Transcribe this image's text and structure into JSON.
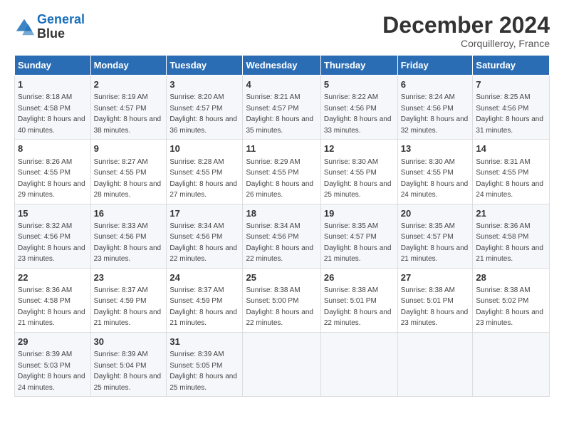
{
  "logo": {
    "line1": "General",
    "line2": "Blue"
  },
  "title": "December 2024",
  "location": "Corquilleroy, France",
  "headers": [
    "Sunday",
    "Monday",
    "Tuesday",
    "Wednesday",
    "Thursday",
    "Friday",
    "Saturday"
  ],
  "weeks": [
    [
      {
        "day": "1",
        "sunrise": "Sunrise: 8:18 AM",
        "sunset": "Sunset: 4:58 PM",
        "daylight": "Daylight: 8 hours and 40 minutes."
      },
      {
        "day": "2",
        "sunrise": "Sunrise: 8:19 AM",
        "sunset": "Sunset: 4:57 PM",
        "daylight": "Daylight: 8 hours and 38 minutes."
      },
      {
        "day": "3",
        "sunrise": "Sunrise: 8:20 AM",
        "sunset": "Sunset: 4:57 PM",
        "daylight": "Daylight: 8 hours and 36 minutes."
      },
      {
        "day": "4",
        "sunrise": "Sunrise: 8:21 AM",
        "sunset": "Sunset: 4:57 PM",
        "daylight": "Daylight: 8 hours and 35 minutes."
      },
      {
        "day": "5",
        "sunrise": "Sunrise: 8:22 AM",
        "sunset": "Sunset: 4:56 PM",
        "daylight": "Daylight: 8 hours and 33 minutes."
      },
      {
        "day": "6",
        "sunrise": "Sunrise: 8:24 AM",
        "sunset": "Sunset: 4:56 PM",
        "daylight": "Daylight: 8 hours and 32 minutes."
      },
      {
        "day": "7",
        "sunrise": "Sunrise: 8:25 AM",
        "sunset": "Sunset: 4:56 PM",
        "daylight": "Daylight: 8 hours and 31 minutes."
      }
    ],
    [
      {
        "day": "8",
        "sunrise": "Sunrise: 8:26 AM",
        "sunset": "Sunset: 4:55 PM",
        "daylight": "Daylight: 8 hours and 29 minutes."
      },
      {
        "day": "9",
        "sunrise": "Sunrise: 8:27 AM",
        "sunset": "Sunset: 4:55 PM",
        "daylight": "Daylight: 8 hours and 28 minutes."
      },
      {
        "day": "10",
        "sunrise": "Sunrise: 8:28 AM",
        "sunset": "Sunset: 4:55 PM",
        "daylight": "Daylight: 8 hours and 27 minutes."
      },
      {
        "day": "11",
        "sunrise": "Sunrise: 8:29 AM",
        "sunset": "Sunset: 4:55 PM",
        "daylight": "Daylight: 8 hours and 26 minutes."
      },
      {
        "day": "12",
        "sunrise": "Sunrise: 8:30 AM",
        "sunset": "Sunset: 4:55 PM",
        "daylight": "Daylight: 8 hours and 25 minutes."
      },
      {
        "day": "13",
        "sunrise": "Sunrise: 8:30 AM",
        "sunset": "Sunset: 4:55 PM",
        "daylight": "Daylight: 8 hours and 24 minutes."
      },
      {
        "day": "14",
        "sunrise": "Sunrise: 8:31 AM",
        "sunset": "Sunset: 4:55 PM",
        "daylight": "Daylight: 8 hours and 24 minutes."
      }
    ],
    [
      {
        "day": "15",
        "sunrise": "Sunrise: 8:32 AM",
        "sunset": "Sunset: 4:56 PM",
        "daylight": "Daylight: 8 hours and 23 minutes."
      },
      {
        "day": "16",
        "sunrise": "Sunrise: 8:33 AM",
        "sunset": "Sunset: 4:56 PM",
        "daylight": "Daylight: 8 hours and 23 minutes."
      },
      {
        "day": "17",
        "sunrise": "Sunrise: 8:34 AM",
        "sunset": "Sunset: 4:56 PM",
        "daylight": "Daylight: 8 hours and 22 minutes."
      },
      {
        "day": "18",
        "sunrise": "Sunrise: 8:34 AM",
        "sunset": "Sunset: 4:56 PM",
        "daylight": "Daylight: 8 hours and 22 minutes."
      },
      {
        "day": "19",
        "sunrise": "Sunrise: 8:35 AM",
        "sunset": "Sunset: 4:57 PM",
        "daylight": "Daylight: 8 hours and 21 minutes."
      },
      {
        "day": "20",
        "sunrise": "Sunrise: 8:35 AM",
        "sunset": "Sunset: 4:57 PM",
        "daylight": "Daylight: 8 hours and 21 minutes."
      },
      {
        "day": "21",
        "sunrise": "Sunrise: 8:36 AM",
        "sunset": "Sunset: 4:58 PM",
        "daylight": "Daylight: 8 hours and 21 minutes."
      }
    ],
    [
      {
        "day": "22",
        "sunrise": "Sunrise: 8:36 AM",
        "sunset": "Sunset: 4:58 PM",
        "daylight": "Daylight: 8 hours and 21 minutes."
      },
      {
        "day": "23",
        "sunrise": "Sunrise: 8:37 AM",
        "sunset": "Sunset: 4:59 PM",
        "daylight": "Daylight: 8 hours and 21 minutes."
      },
      {
        "day": "24",
        "sunrise": "Sunrise: 8:37 AM",
        "sunset": "Sunset: 4:59 PM",
        "daylight": "Daylight: 8 hours and 21 minutes."
      },
      {
        "day": "25",
        "sunrise": "Sunrise: 8:38 AM",
        "sunset": "Sunset: 5:00 PM",
        "daylight": "Daylight: 8 hours and 22 minutes."
      },
      {
        "day": "26",
        "sunrise": "Sunrise: 8:38 AM",
        "sunset": "Sunset: 5:01 PM",
        "daylight": "Daylight: 8 hours and 22 minutes."
      },
      {
        "day": "27",
        "sunrise": "Sunrise: 8:38 AM",
        "sunset": "Sunset: 5:01 PM",
        "daylight": "Daylight: 8 hours and 23 minutes."
      },
      {
        "day": "28",
        "sunrise": "Sunrise: 8:38 AM",
        "sunset": "Sunset: 5:02 PM",
        "daylight": "Daylight: 8 hours and 23 minutes."
      }
    ],
    [
      {
        "day": "29",
        "sunrise": "Sunrise: 8:39 AM",
        "sunset": "Sunset: 5:03 PM",
        "daylight": "Daylight: 8 hours and 24 minutes."
      },
      {
        "day": "30",
        "sunrise": "Sunrise: 8:39 AM",
        "sunset": "Sunset: 5:04 PM",
        "daylight": "Daylight: 8 hours and 25 minutes."
      },
      {
        "day": "31",
        "sunrise": "Sunrise: 8:39 AM",
        "sunset": "Sunset: 5:05 PM",
        "daylight": "Daylight: 8 hours and 25 minutes."
      },
      null,
      null,
      null,
      null
    ]
  ]
}
